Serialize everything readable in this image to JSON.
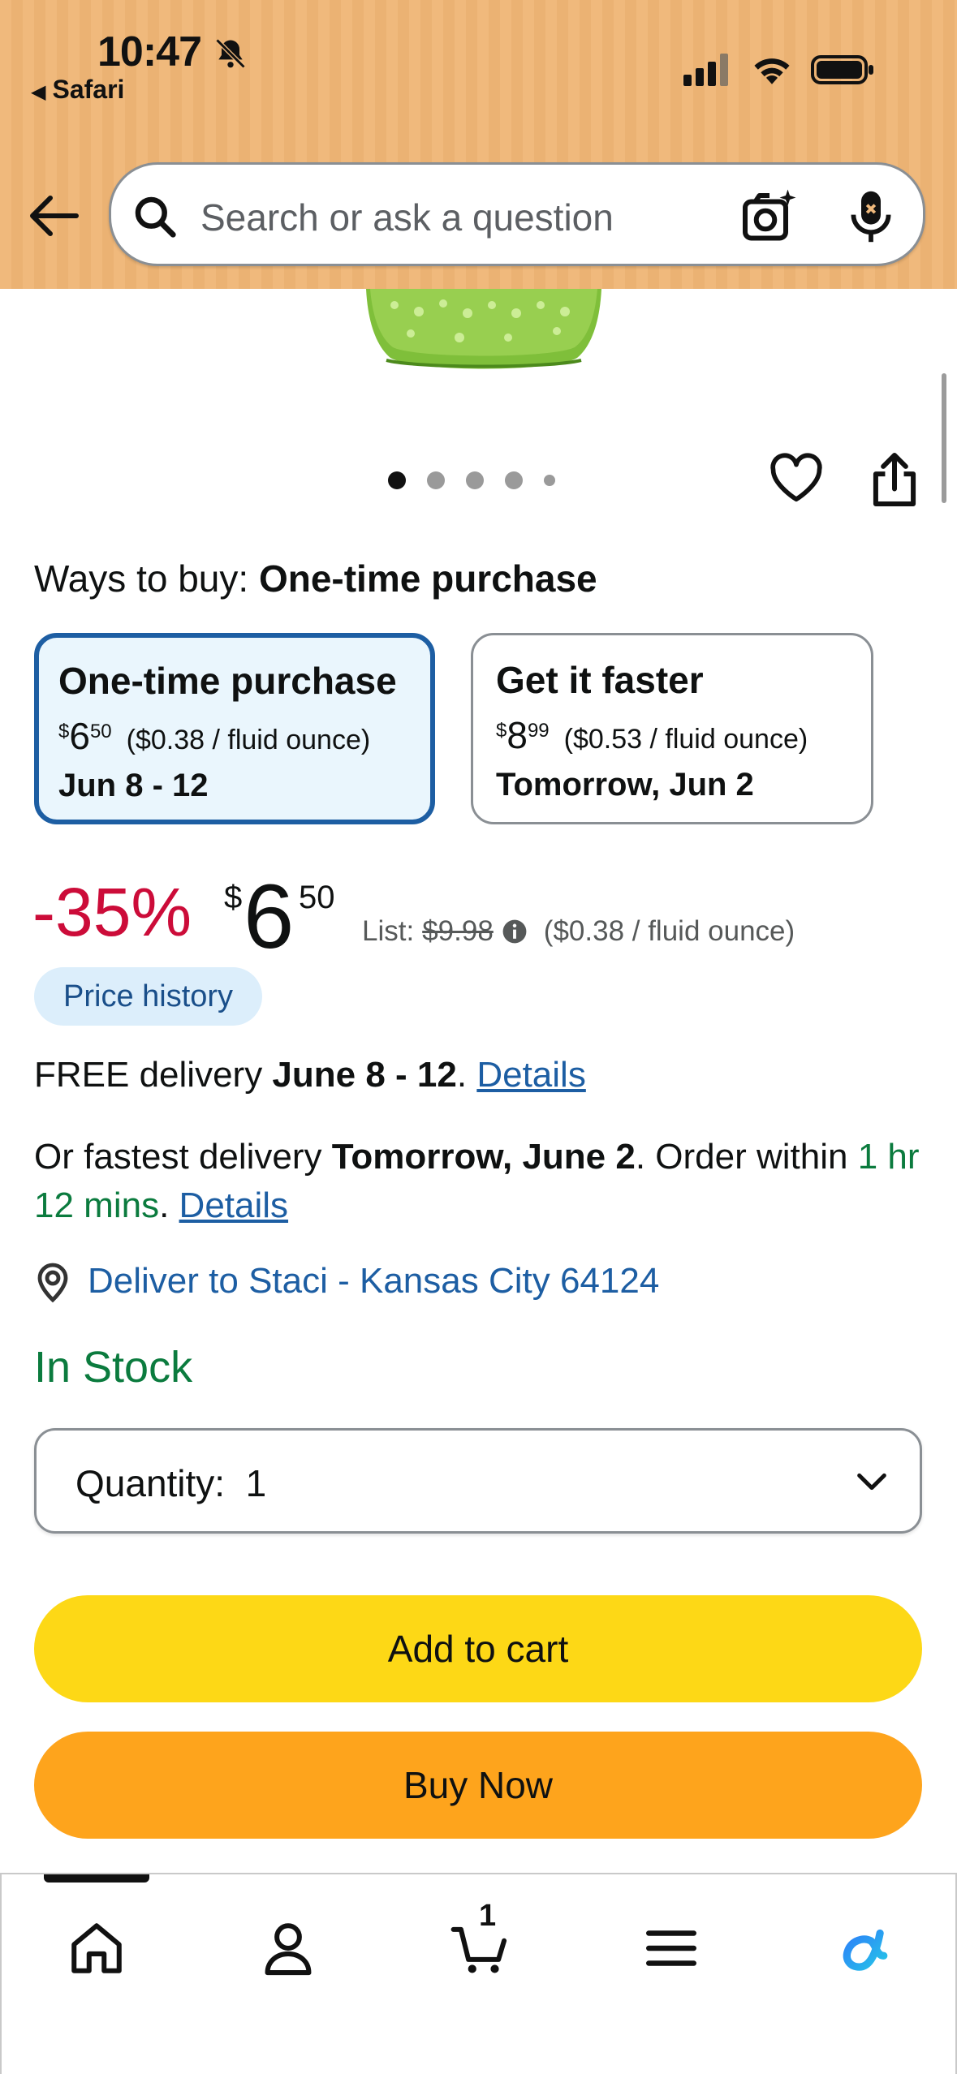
{
  "status_bar": {
    "time": "10:47",
    "back_app": "Safari"
  },
  "search": {
    "placeholder": "Search or ask a question"
  },
  "gallery": {
    "image_count": 5,
    "active_index": 0
  },
  "ways_to_buy": {
    "label": "Ways to buy:",
    "selected": "One-time purchase",
    "options": [
      {
        "title": "One-time purchase",
        "currency": "$",
        "price_whole": "6",
        "price_fraction": "50",
        "unit_price": "($0.38 / fluid ounce)",
        "delivery": "Jun 8 - 12"
      },
      {
        "title": "Get it faster",
        "currency": "$",
        "price_whole": "8",
        "price_fraction": "99",
        "unit_price": "($0.53 / fluid ounce)",
        "delivery": "Tomorrow, Jun 2"
      }
    ]
  },
  "pricing": {
    "discount": "-35%",
    "currency": "$",
    "price_whole": "6",
    "price_fraction": "50",
    "list_label": "List:",
    "list_price": "$9.98",
    "unit_price": "($0.38 / fluid ounce)",
    "price_history_label": "Price history"
  },
  "delivery": {
    "free_prefix": "FREE delivery",
    "free_dates": "June 8 - 12",
    "free_suffix": ".",
    "details_link": "Details",
    "fastest_prefix": "Or fastest delivery",
    "fastest_date": "Tomorrow, June 2",
    "fastest_mid": ". Order within",
    "countdown": "1 hr 12 mins",
    "fastest_suffix": ".",
    "deliver_to": "Deliver to Staci - Kansas City 64124"
  },
  "stock": {
    "status": "In Stock"
  },
  "quantity": {
    "label": "Quantity:",
    "value": "1"
  },
  "buttons": {
    "add_to_cart": "Add to cart",
    "buy_now": "Buy Now"
  },
  "tabbar": {
    "cart_count": "1",
    "active_tab": "home"
  },
  "colors": {
    "header_orange": "#f0b97c",
    "discount_red": "#cc0c39",
    "link_blue": "#1d5ea3",
    "stock_green": "#0b7b3e",
    "add_to_cart_yellow": "#fdd816",
    "buy_now_orange": "#fea41c"
  }
}
